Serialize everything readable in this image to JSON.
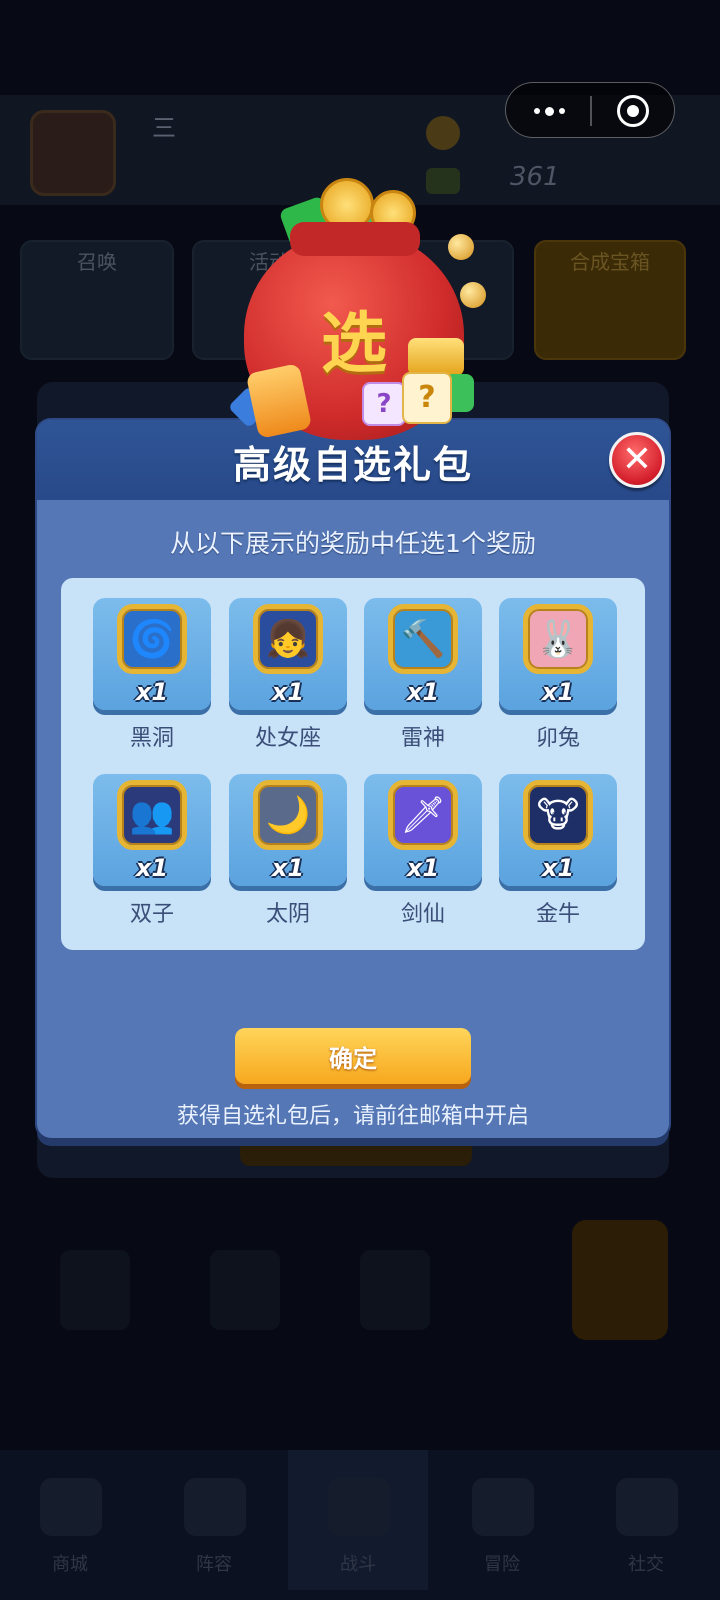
{
  "background": {
    "player_name": "三",
    "player_sub1": "",
    "player_sub2": "",
    "currency_value": "361",
    "cards": [
      {
        "label": "召唤"
      },
      {
        "label": "活动"
      },
      {
        "label": ""
      },
      {
        "label": "合成宝箱"
      }
    ],
    "chest_label": "",
    "nav": [
      {
        "label": "商城"
      },
      {
        "label": "阵容"
      },
      {
        "label": "战斗"
      },
      {
        "label": "冒险"
      },
      {
        "label": "社交"
      }
    ]
  },
  "capsule": {
    "more_icon": "more-dots-icon",
    "close_icon": "close-circle-icon"
  },
  "bag": {
    "character": "选",
    "dice_marks": [
      "?",
      "?"
    ]
  },
  "dialog": {
    "title": "高级自选礼包",
    "close_label": "✕",
    "instruction": "从以下展示的奖励中任选1个奖励",
    "rewards": [
      {
        "name": "黑洞",
        "count": "x1",
        "icon": "black-hole-icon",
        "glyph": "🌀",
        "color": "#2a6fc9"
      },
      {
        "name": "处女座",
        "count": "x1",
        "icon": "virgo-icon",
        "glyph": "👧",
        "color": "#2b4d9e"
      },
      {
        "name": "雷神",
        "count": "x1",
        "icon": "thor-hammer-icon",
        "glyph": "🔨",
        "color": "#3a9ad8"
      },
      {
        "name": "卯兔",
        "count": "x1",
        "icon": "rabbit-icon",
        "glyph": "🐰",
        "color": "#f0a6b4"
      },
      {
        "name": "双子",
        "count": "x1",
        "icon": "gemini-icon",
        "glyph": "👥",
        "color": "#2a3a7a"
      },
      {
        "name": "太阴",
        "count": "x1",
        "icon": "moon-icon",
        "glyph": "🌙",
        "color": "#5a6a8a"
      },
      {
        "name": "剑仙",
        "count": "x1",
        "icon": "sword-immortal-icon",
        "glyph": "🗡",
        "color": "#6a52d8"
      },
      {
        "name": "金牛",
        "count": "x1",
        "icon": "taurus-icon",
        "glyph": "🐮",
        "color": "#1d2f66"
      }
    ],
    "confirm_label": "确定",
    "footnote": "获得自选礼包后，请前往邮箱中开启"
  }
}
